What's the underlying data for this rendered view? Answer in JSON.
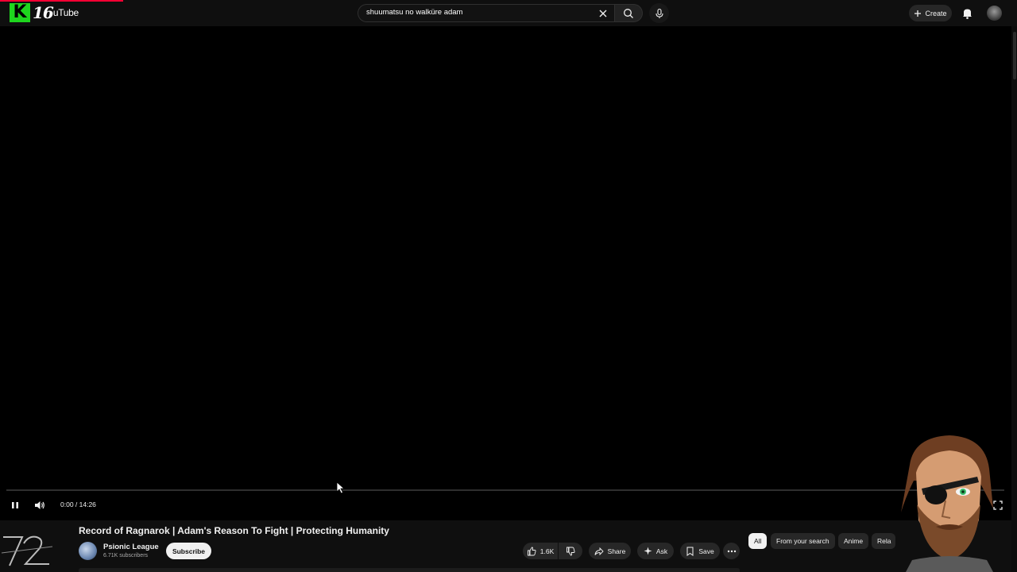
{
  "header": {
    "logo_badge": "16",
    "logo_text": "uTube",
    "search": {
      "value": "shuumatsu no walküre adam"
    },
    "create_label": "Create"
  },
  "player": {
    "time": "0:00 / 14:26",
    "progress_fraction": 0.0,
    "state": "playing"
  },
  "video": {
    "title": "Record of Ragnarok | Adam's Reason To Fight | Protecting Humanity",
    "channel": {
      "name": "Psionic League",
      "subscribers": "6.71K subscribers"
    },
    "subscribe_label": "Subscribe",
    "actions": {
      "likes": "1.6K",
      "share": "Share",
      "ask": "Ask",
      "save": "Save"
    }
  },
  "chips": [
    {
      "label": "All",
      "active": true
    },
    {
      "label": "From your search",
      "active": false
    },
    {
      "label": "Anime",
      "active": false
    },
    {
      "label": "Rela",
      "active": false
    }
  ],
  "colors": {
    "background": "#0f0f0f",
    "accent_red": "#ff0033",
    "logo_green": "#1ed61e"
  },
  "icons": [
    "search-icon",
    "clear-icon",
    "mic-icon",
    "plus-icon",
    "bell-icon",
    "pause-icon",
    "volume-icon",
    "fullscreen-icon",
    "like-icon",
    "dislike-icon",
    "share-icon",
    "sparkle-icon",
    "save-icon",
    "more-icon"
  ]
}
